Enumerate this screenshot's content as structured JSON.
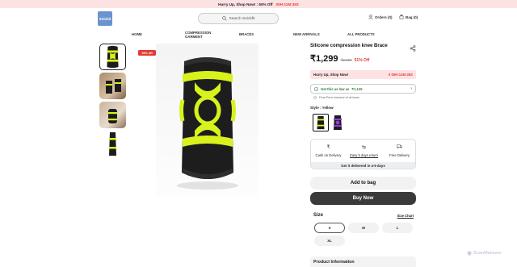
{
  "promo_bar": {
    "text": "Hurry Up, Shop Now! : 50% Off",
    "timer": "00H:11M:35S"
  },
  "header": {
    "logo_text": "Snickit",
    "search_placeholder": "Search Snickfit",
    "orders_label": "Orders (0)",
    "bag_label": "Bag (0)"
  },
  "nav": {
    "items": [
      {
        "label": "HOME"
      },
      {
        "label": "COMPRESSION GARMENT"
      },
      {
        "label": "BRACES"
      },
      {
        "label": "NEW ARRIVALS"
      },
      {
        "label": "ALL PRODUCTS"
      }
    ]
  },
  "gallery": {
    "discount_badge": "51% off"
  },
  "product": {
    "title": "Silicone compression knee Brace",
    "price": "₹1,299",
    "mrp": "₹2,699",
    "discount": "51% Off"
  },
  "hurry_box": {
    "text": "Hurry Up, Shop Now!",
    "timer": "0 00H:11M:35S"
  },
  "offer": {
    "prefix": "Get this as low as",
    "price": "₹1,125",
    "final_price_note": "Final Price inclusive of all taxes"
  },
  "style": {
    "label": "Style : Yellow",
    "options": [
      "Yellow",
      "Purple"
    ],
    "selected": "Yellow"
  },
  "benefits": {
    "items": [
      {
        "icon": "rupee-icon",
        "label": "Cash on Delivery"
      },
      {
        "icon": "return-icon",
        "label": "Easy 5 days return"
      },
      {
        "icon": "truck-icon",
        "label": "Free Delivery"
      }
    ],
    "delivery_text": "Get it delivered in 4-9 days"
  },
  "actions": {
    "add_to_bag": "Add to bag",
    "buy_now": "Buy Now"
  },
  "size": {
    "label": "Size",
    "chart_link": "Size Chart",
    "options": [
      "S",
      "M",
      "L",
      "XL"
    ],
    "selected": "S"
  },
  "product_info": {
    "label": "Product Information"
  },
  "watermark": {
    "text": "ScanMalware"
  },
  "colors": {
    "accent_red": "#e53935",
    "promo_bg": "#fde2e4",
    "brace_yellow": "#d7f21c",
    "buy_button": "#3a3a3a"
  }
}
